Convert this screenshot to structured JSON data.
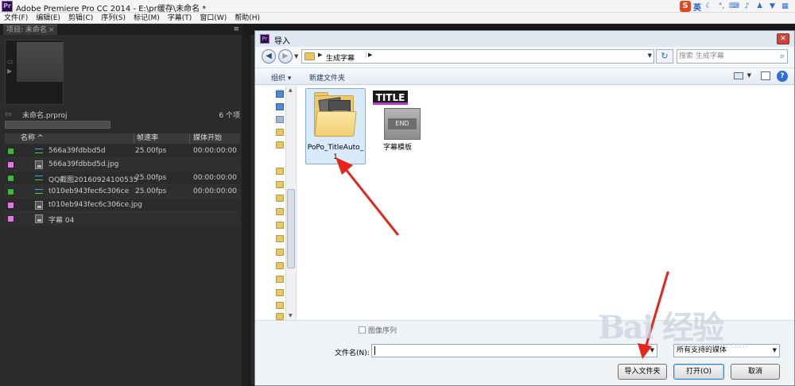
{
  "app": {
    "logo_text": "Pr",
    "title": "Adobe Premiere Pro CC 2014 - E:\\pr缓存\\未命名 *"
  },
  "ime": {
    "logo_text": "S",
    "lang": "英",
    "icons": [
      "moon-icon",
      "comma-icon",
      "keyboard-icon",
      "mic-icon",
      "user-icon",
      "shirt-icon",
      "grid-icon"
    ]
  },
  "menu": [
    "文件(F)",
    "编辑(E)",
    "剪辑(C)",
    "序列(S)",
    "标记(M)",
    "字幕(T)",
    "窗口(W)",
    "帮助(H)"
  ],
  "project": {
    "tab_label": "项目: 未命名",
    "tab_close": "×",
    "panel_menu": "≡",
    "file_name": "未命名.prproj",
    "item_count": "6 个项",
    "columns": {
      "name": "名称 ^",
      "fps": "帧速率",
      "start": "媒体开始"
    },
    "rows": [
      {
        "color": "#3fb63f",
        "icon": "sequence",
        "name": "566a39fdbbd5d",
        "fps": "25.00fps",
        "start": "00:00:00:00"
      },
      {
        "color": "#e279e2",
        "icon": "image",
        "name": "566a39fdbbd5d.jpg",
        "fps": "",
        "start": ""
      },
      {
        "color": "#3fb63f",
        "icon": "sequence",
        "name": "QQ截图20160924100535",
        "fps": "25.00fps",
        "start": "00:00:00:00"
      },
      {
        "color": "#3fb63f",
        "icon": "sequence",
        "name": "t010eb943fec6c306ce",
        "fps": "25.00fps",
        "start": "00:00:00:00"
      },
      {
        "color": "#e279e2",
        "icon": "image",
        "name": "t010eb943fec6c306ce.jpg",
        "fps": "",
        "start": ""
      },
      {
        "color": "#e279e2",
        "icon": "image",
        "name": "字幕 04",
        "fps": "",
        "start": ""
      }
    ]
  },
  "dialog": {
    "logo_text": "Pr",
    "title": "导入",
    "close_glyph": "✕",
    "back_glyph": "◀",
    "fwd_glyph": "▶",
    "breadcrumb": "生成字幕",
    "search_placeholder": "搜索 生成字幕",
    "organize": "组织 ▾",
    "new_folder": "新建文件夹",
    "help_glyph": "?",
    "items": [
      {
        "label": "PoPo_TitleAuto_1",
        "selected": true
      },
      {
        "label": "字幕模板",
        "selected": false,
        "thumb_title": "TITLE",
        "thumb_end": "END"
      }
    ],
    "image_sequence_label": "图像序列",
    "filename_label": "文件名(N):",
    "filename_value": "",
    "filter_value": "所有支持的媒体",
    "buttons": {
      "import_folder": "导入文件夹",
      "open": "打开(O)",
      "cancel": "取消"
    }
  },
  "watermark": {
    "text": "Bai 经验",
    "sub": "jingyan.baidu.com"
  }
}
